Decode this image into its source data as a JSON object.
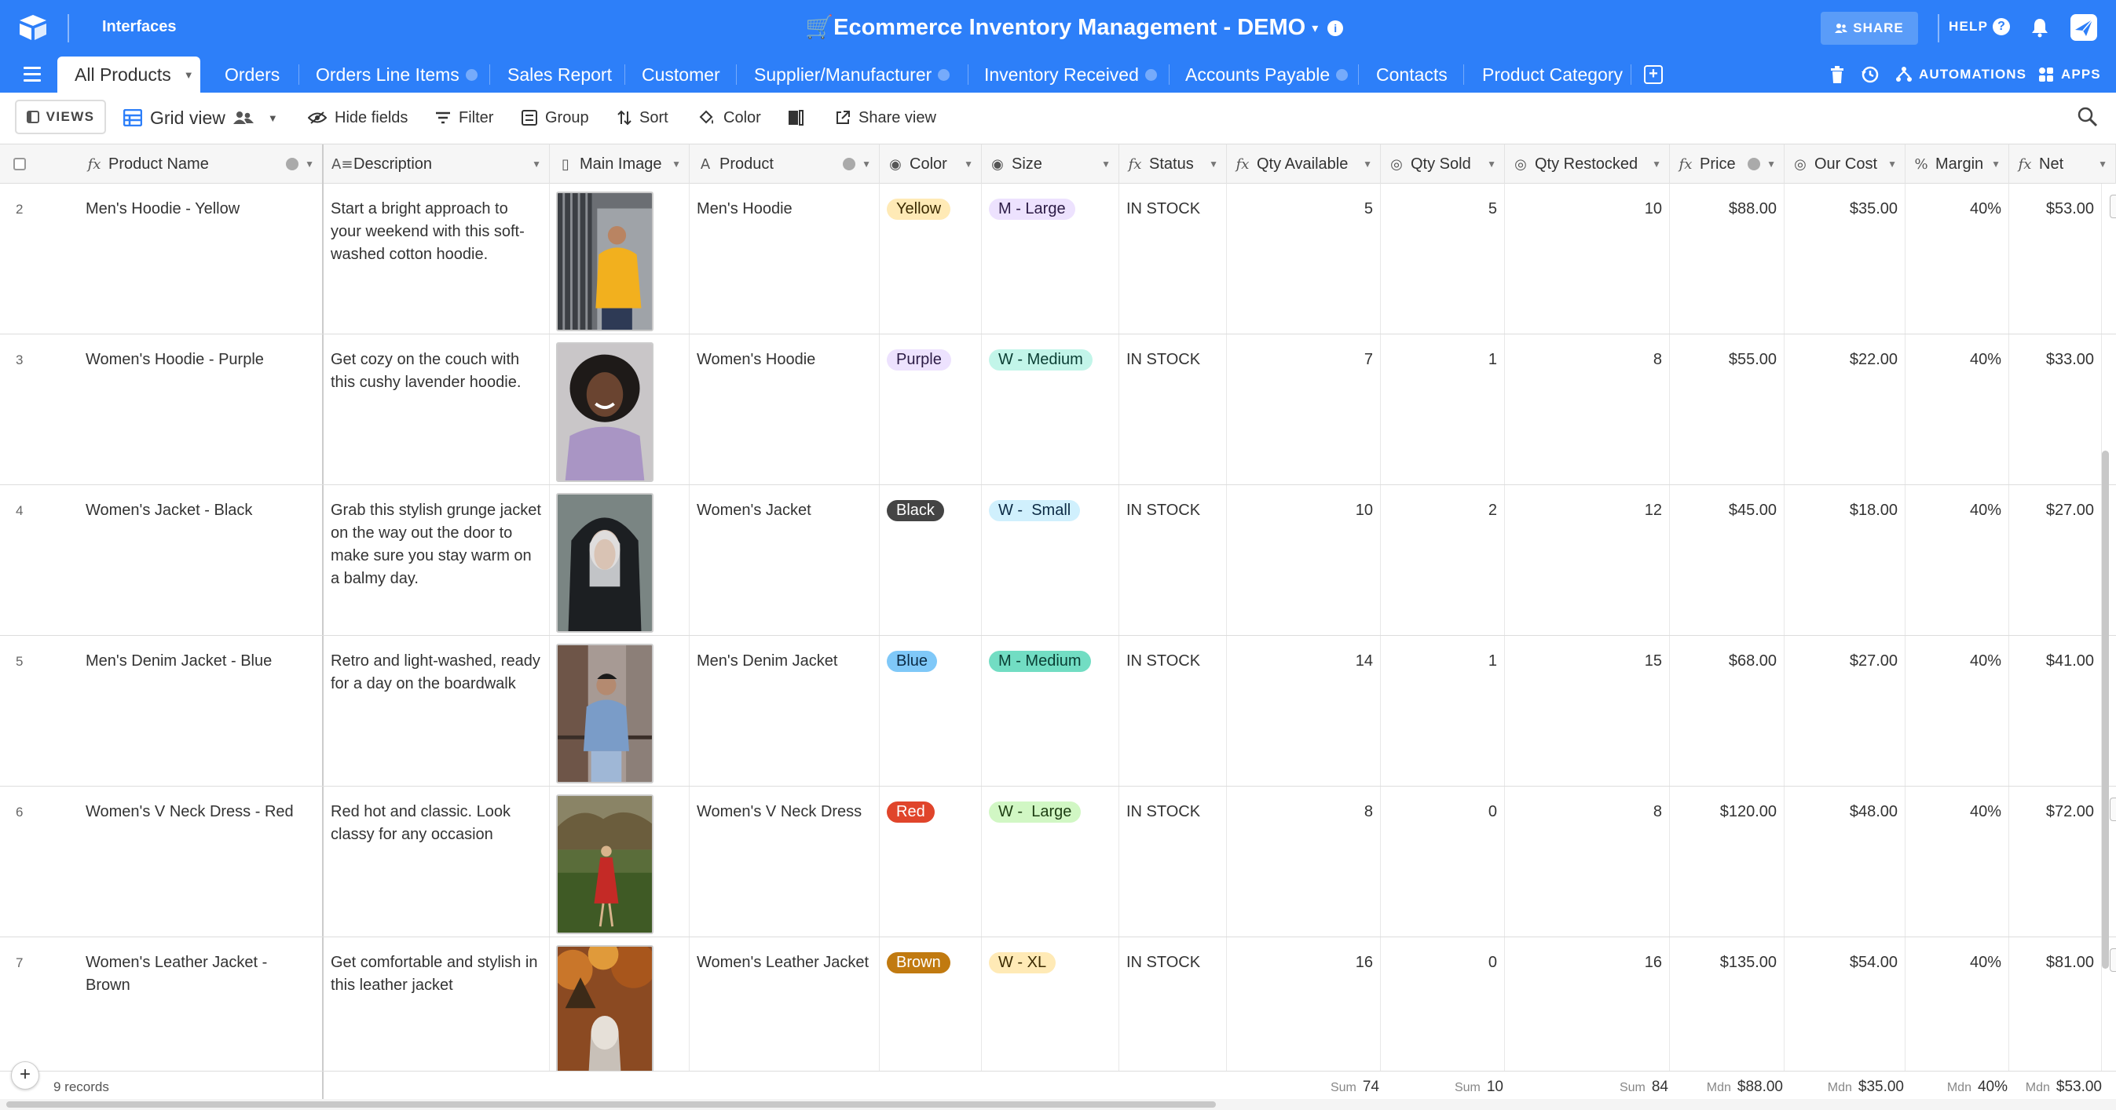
{
  "header": {
    "interfaces_label": "Interfaces",
    "base_title": "🛒Ecommerce Inventory Management - DEMO",
    "share_label": "SHARE",
    "help_label": "HELP"
  },
  "tabs": [
    {
      "label": "All Products",
      "active": true
    },
    {
      "label": "Orders"
    },
    {
      "label": "Orders Line Items"
    },
    {
      "label": "Sales Report"
    },
    {
      "label": "Customer"
    },
    {
      "label": "Supplier/Manufacturer"
    },
    {
      "label": "Inventory Received"
    },
    {
      "label": "Accounts Payable"
    },
    {
      "label": "Contacts"
    },
    {
      "label": "Product Category"
    }
  ],
  "tabbar_right": {
    "automations_label": "AUTOMATIONS",
    "apps_label": "APPS"
  },
  "toolbar": {
    "views_label": "VIEWS",
    "view_name": "Grid view",
    "hide_fields": "Hide fields",
    "filter": "Filter",
    "group": "Group",
    "sort": "Sort",
    "color": "Color",
    "share_view": "Share view"
  },
  "columns": {
    "product_name": "Product Name",
    "description": "Description",
    "main_image": "Main Image",
    "product": "Product",
    "color": "Color",
    "size": "Size",
    "status": "Status",
    "qty_available": "Qty Available",
    "qty_sold": "Qty Sold",
    "qty_restocked": "Qty Restocked",
    "price": "Price",
    "our_cost": "Our Cost",
    "margin": "Margin",
    "net": "Net"
  },
  "rows": [
    {
      "num": "2",
      "name": "Men's Hoodie - Yellow",
      "desc": "Start a bright approach to your weekend with this soft-washed cotton hoodie.",
      "product": "Men's Hoodie",
      "color": "Yellow",
      "size": "M - Large",
      "status": "IN STOCK",
      "qa": "5",
      "qs": "5",
      "qr": "10",
      "price": "$88.00",
      "cost": "$35.00",
      "margin": "40%",
      "net": "$53.00"
    },
    {
      "num": "3",
      "name": "Women's Hoodie - Purple",
      "desc": "Get cozy on the couch with this cushy lavender hoodie.",
      "product": "Women's Hoodie",
      "color": "Purple",
      "size": "W - Medium",
      "status": "IN STOCK",
      "qa": "7",
      "qs": "1",
      "qr": "8",
      "price": "$55.00",
      "cost": "$22.00",
      "margin": "40%",
      "net": "$33.00"
    },
    {
      "num": "4",
      "name": "Women's Jacket - Black",
      "desc": "Grab this stylish grunge jacket on the way out the door to make sure you stay warm on a balmy day.",
      "product": "Women's Jacket",
      "color": "Black",
      "size": "W -  Small",
      "status": "IN STOCK",
      "qa": "10",
      "qs": "2",
      "qr": "12",
      "price": "$45.00",
      "cost": "$18.00",
      "margin": "40%",
      "net": "$27.00"
    },
    {
      "num": "5",
      "name": "Men's Denim Jacket - Blue",
      "desc": "Retro and light-washed, ready for a day on the boardwalk",
      "product": "Men's Denim Jacket",
      "color": "Blue",
      "size": "M - Medium",
      "status": "IN STOCK",
      "qa": "14",
      "qs": "1",
      "qr": "15",
      "price": "$68.00",
      "cost": "$27.00",
      "margin": "40%",
      "net": "$41.00"
    },
    {
      "num": "6",
      "name": "Women's V Neck Dress - Red",
      "desc": "Red hot and classic. Look classy for any occasion",
      "product": "Women's V Neck Dress",
      "color": "Red",
      "size": "W -  Large",
      "status": "IN STOCK",
      "qa": "8",
      "qs": "0",
      "qr": "8",
      "price": "$120.00",
      "cost": "$48.00",
      "margin": "40%",
      "net": "$72.00"
    },
    {
      "num": "7",
      "name": "Women's Leather Jacket - Brown",
      "desc": "Get comfortable and stylish in this leather jacket",
      "product": "Women's Leather Jacket",
      "color": "Brown",
      "size": "W - XL",
      "status": "IN STOCK",
      "qa": "16",
      "qs": "0",
      "qr": "16",
      "price": "$135.00",
      "cost": "$54.00",
      "margin": "40%",
      "net": "$81.00"
    }
  ],
  "color_pills": {
    "Yellow": {
      "bg": "#ffeab6",
      "fg": "#3b2a00"
    },
    "Purple": {
      "bg": "#ede2fe",
      "fg": "#2b1b45"
    },
    "Black": {
      "bg": "#444444",
      "fg": "#ffffff"
    },
    "Blue": {
      "bg": "#7fc8f8",
      "fg": "#0b2a44"
    },
    "Red": {
      "bg": "#e0452b",
      "fg": "#ffffff"
    },
    "Brown": {
      "bg": "#c17a10",
      "fg": "#ffffff"
    }
  },
  "size_pills": {
    "M - Large": {
      "bg": "#ede2fe",
      "fg": "#2b1b45"
    },
    "W - Medium": {
      "bg": "#c2f5e9",
      "fg": "#0a3d33"
    },
    "W -  Small": {
      "bg": "#d0f0fd",
      "fg": "#0b2a44"
    },
    "M - Medium": {
      "bg": "#72ddc3",
      "fg": "#0a3d33"
    },
    "W -  Large": {
      "bg": "#d1f7c4",
      "fg": "#1d3d12"
    },
    "W - XL": {
      "bg": "#ffeab6",
      "fg": "#3b2a00"
    }
  },
  "footer": {
    "records": "9 records",
    "qa_label": "Sum",
    "qa_value": "74",
    "qs_label": "Sum",
    "qs_value": "10",
    "qr_label": "Sum",
    "qr_value": "84",
    "price_label": "Mdn",
    "price_value": "$88.00",
    "cost_label": "Mdn",
    "cost_value": "$35.00",
    "margin_label": "Mdn",
    "margin_value": "40%",
    "net_label": "Mdn",
    "net_value": "$53.00"
  },
  "colors": {
    "brand_blue": "#2d7ff9"
  }
}
